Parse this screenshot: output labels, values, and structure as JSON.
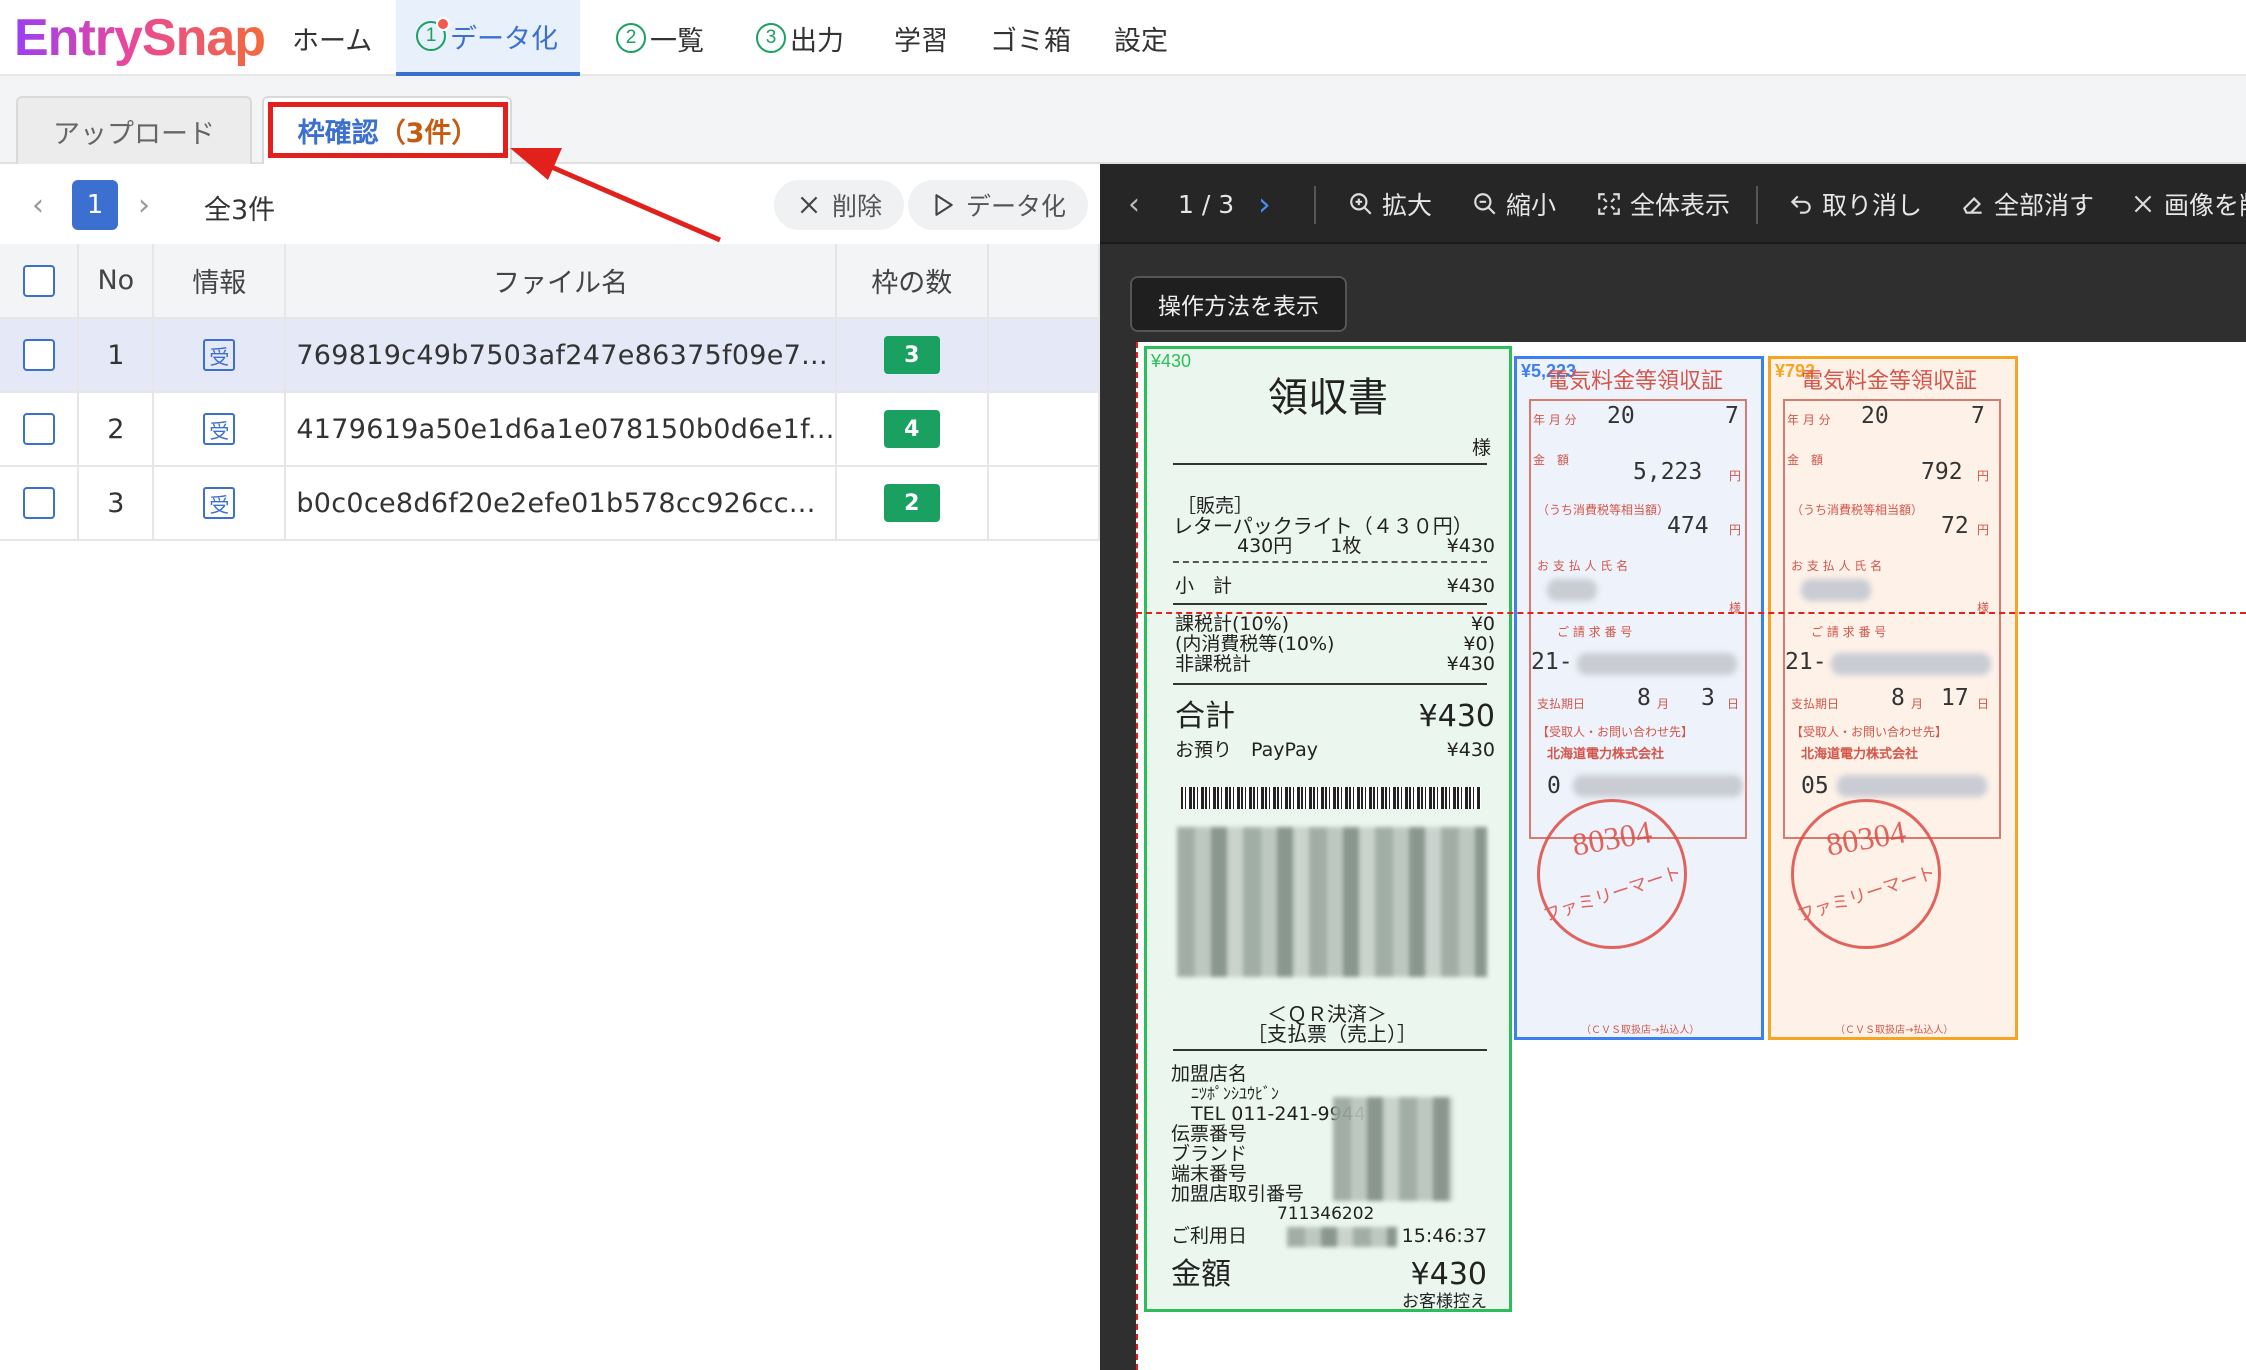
{
  "app": {
    "logo": "EntrySnap"
  },
  "nav": {
    "home": "ホーム",
    "step1_num": "1",
    "step1_label": "データ化",
    "step2_num": "2",
    "step2_label": "一覧",
    "step3_num": "3",
    "step3_label": "出力",
    "learn": "学習",
    "trash": "ゴミ箱",
    "settings": "設定"
  },
  "subtabs": {
    "upload": "アップロード",
    "confirm_a": "枠確認",
    "confirm_b": "（3件）"
  },
  "left": {
    "prev": "‹",
    "page": "1",
    "next": "›",
    "total": "全3件",
    "delete": "削除",
    "digitize": "データ化",
    "columns": {
      "no": "No",
      "info": "情報",
      "filename": "ファイル名",
      "frames": "枠の数"
    },
    "rows": [
      {
        "no": "1",
        "info": "受",
        "filename": "769819c49b7503af247e86375f09e7...",
        "frames": "3"
      },
      {
        "no": "2",
        "info": "受",
        "filename": "4179619a50e1d6a1e078150b0d6e1f...",
        "frames": "4"
      },
      {
        "no": "3",
        "info": "受",
        "filename": "b0c0ce8d6f20e2efe01b578cc926cc...",
        "frames": "2"
      }
    ]
  },
  "viewer": {
    "page_indicator": "1 / 3",
    "zoom_in": "拡大",
    "zoom_out": "縮小",
    "fit": "全体表示",
    "undo": "取り消し",
    "clear_all": "全部消す",
    "image_action": "画像を削",
    "help": "操作方法を表示"
  },
  "receipt": {
    "tag": "¥430",
    "title": "領収書",
    "sama": "様",
    "category": "［販売］",
    "item": "レターパックライト（４３０円）",
    "item_detail": "430円　　1枚",
    "item_price": "¥430",
    "subtotal_label": "小　計",
    "subtotal": "¥430",
    "tax1_label": "課税計(10%)",
    "tax1": "¥0",
    "tax2_label": "(内消費税等(10%)",
    "tax2": "¥0)",
    "tax3_label": "非課税計",
    "tax3": "¥430",
    "total_label": "合計",
    "total": "¥430",
    "deposit_label": "お預り　PayPay",
    "deposit": "¥430",
    "qr": "＜ＱＲ決済＞",
    "slip": "［支払票（売上）］",
    "store_label": "加盟店名",
    "store_name": "ﾆﾂﾎﾟﾝｼﾕｳﾋﾞﾝ",
    "tel": "TEL 011-241-9944",
    "slip_no": "伝票番号",
    "brand": "ブランド",
    "terminal": "端末番号",
    "merchant_id": "加盟店取引番号",
    "merchant_num": "711346202",
    "date_label": "ご利用日",
    "time": "15:46:37",
    "amount_label": "金額",
    "amount": "¥430",
    "footer": "お客様控え"
  },
  "slip1": {
    "tag": "¥5,223",
    "title": "電気料金等領収証",
    "year_label": "年 月 分",
    "year": "20",
    "month": "7",
    "amount_label": "金　額",
    "amount": "5,223",
    "yen": "円",
    "tax_label": "（うち消費税等相当額）",
    "tax": "474",
    "payer_label": "お 支 払 人 氏 名",
    "sama": "様",
    "invoice_label": "ご 請 求 番 号",
    "invoice": "21-",
    "due_label": "支払期日",
    "due_m": "8",
    "due_d": "3",
    "m": "月",
    "d": "日",
    "recipient": "【受取人・お問い合わせ先】",
    "company": "北海道電力株式会社",
    "phone": "0",
    "stamp_num": "80304",
    "stamp_name": "ファミリーマート",
    "footer": "（ＣＶＳ取扱店→払込人）"
  },
  "slip2": {
    "tag": "¥792",
    "title": "電気料金等領収証",
    "year_label": "年 月 分",
    "year": "20",
    "month": "7",
    "amount_label": "金　額",
    "amount": "792",
    "yen": "円",
    "tax_label": "（うち消費税等相当額）",
    "tax": "72",
    "payer_label": "お 支 払 人 氏 名",
    "sama": "様",
    "invoice_label": "ご 請 求 番 号",
    "invoice": "21-",
    "due_label": "支払期日",
    "due_m": "8",
    "due_d": "17",
    "m": "月",
    "d": "日",
    "recipient": "【受取人・お問い合わせ先】",
    "company": "北海道電力株式会社",
    "phone": "05",
    "stamp_num": "80304",
    "stamp_name": "ファミリーマート",
    "footer": "（ＣＶＳ取扱店→払込人）"
  },
  "colors": {
    "accent": "#3b6fd0",
    "green": "#1aa162",
    "red": "#e2211c",
    "slip_blue": "#3d7ef0",
    "slip_orange": "#f5a524",
    "receipt_green": "#2dbd5b"
  }
}
